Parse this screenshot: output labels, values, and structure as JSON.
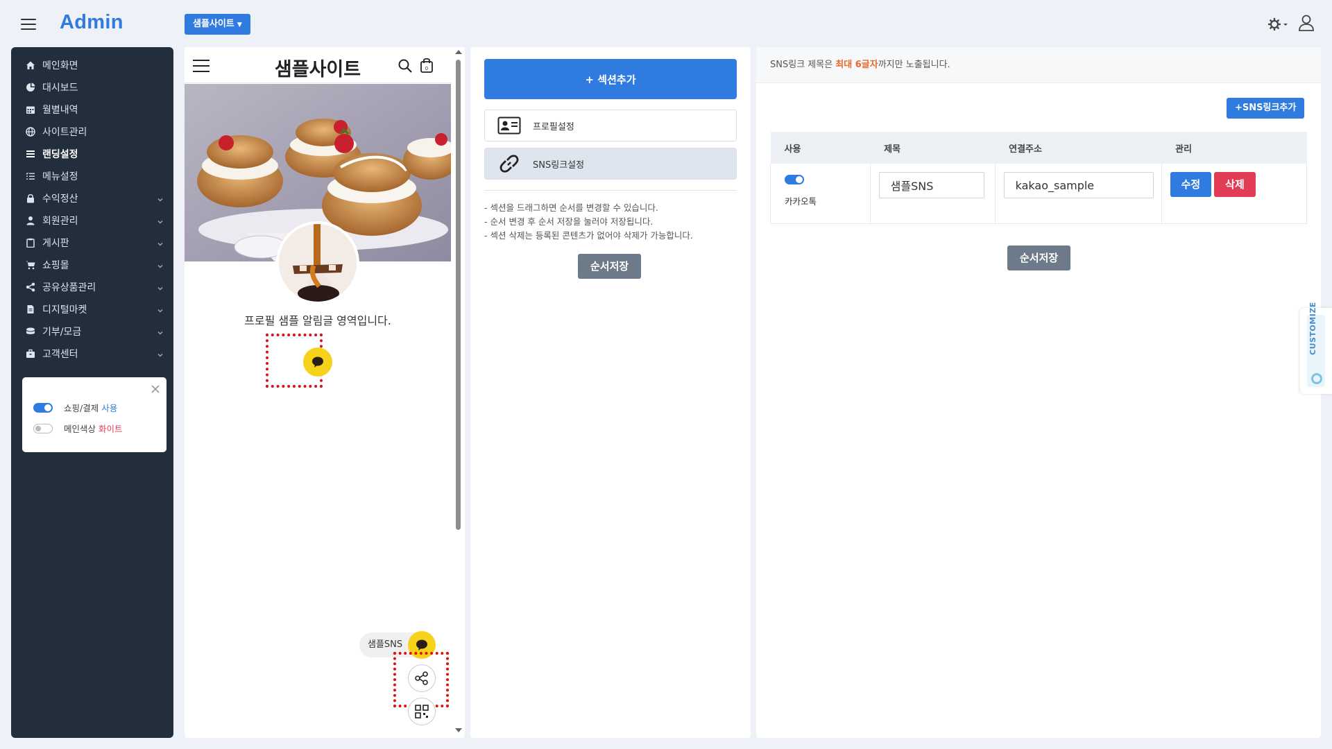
{
  "app": {
    "brand": "Admin",
    "site_selector": "샘플사이트"
  },
  "sidebar": {
    "items": [
      {
        "label": "메인화면",
        "icon": "home-icon"
      },
      {
        "label": "대시보드",
        "icon": "pie-chart-icon"
      },
      {
        "label": "월별내역",
        "icon": "calendar-icon"
      },
      {
        "label": "사이트관리",
        "icon": "globe-icon"
      },
      {
        "label": "랜딩설정",
        "icon": "list-icon",
        "active": true
      },
      {
        "label": "메뉴설정",
        "icon": "list-check-icon"
      },
      {
        "label": "수익정산",
        "icon": "lock-icon",
        "has_submenu": true
      },
      {
        "label": "회원관리",
        "icon": "user-icon",
        "has_submenu": true
      },
      {
        "label": "게시판",
        "icon": "clipboard-icon",
        "has_submenu": true
      },
      {
        "label": "쇼핑몰",
        "icon": "cart-icon",
        "has_submenu": true
      },
      {
        "label": "공유상품관리",
        "icon": "share-icon",
        "has_submenu": true
      },
      {
        "label": "디지털마켓",
        "icon": "file-icon",
        "has_submenu": true
      },
      {
        "label": "기부/모금",
        "icon": "coins-icon",
        "has_submenu": true
      },
      {
        "label": "고객센터",
        "icon": "briefcase-icon",
        "has_submenu": true
      }
    ],
    "settings": {
      "shopping": {
        "label": "쇼핑/결제",
        "accent": "사용",
        "enabled": true
      },
      "theme": {
        "label": "메인색상",
        "accent": "화이트",
        "enabled": false
      }
    }
  },
  "preview": {
    "site_title": "샘플사이트",
    "description": "프로필 샘플 알림글 영역입니다.",
    "sns_label": "샘플SNS"
  },
  "sections": {
    "add_button": "+ 섹션추가",
    "items": [
      {
        "label": "프로필설정",
        "icon": "id-card-icon"
      },
      {
        "label": "SNS링크설정",
        "icon": "link-icon",
        "active": true
      }
    ],
    "notes": [
      "- 섹션을 드래그하면 순서를 변경할 수 있습니다.",
      "- 순서 변경 후 순서 저장을 눌러야 저장됩니다.",
      "- 섹션 삭제는 등록된 콘텐츠가 없어야 삭제가 가능합니다."
    ],
    "save_order": "순서저장"
  },
  "sns": {
    "notice_prefix": "SNS링크 제목은 ",
    "notice_highlight": "최대 6글자",
    "notice_suffix": "까지만 노출됩니다.",
    "add_button": "+SNS링크추가",
    "columns": [
      "사용",
      "제목",
      "연결주소",
      "관리"
    ],
    "rows": [
      {
        "enabled": true,
        "platform": "카카오톡",
        "title": "샘플SNS",
        "url": "kakao_sample",
        "edit": "수정",
        "delete": "삭제"
      }
    ],
    "save_order": "순서저장"
  },
  "customize_tab": "CUSTOMIZE",
  "colors": {
    "primary": "#2f7be0",
    "danger": "#e23b56",
    "sidebar_bg": "#222e3c",
    "kakao_yellow": "#f6d21b",
    "highlight": "#e8692c"
  }
}
